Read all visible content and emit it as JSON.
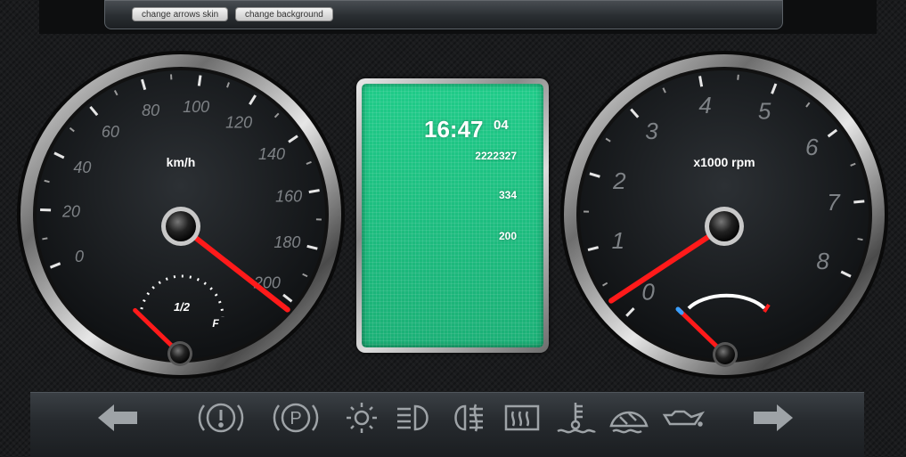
{
  "toolbar": {
    "arrows_label": "change arrows skin",
    "background_label": "change background"
  },
  "speedometer": {
    "unit": "km/h",
    "ticks": [
      "0",
      "20",
      "40",
      "60",
      "80",
      "100",
      "120",
      "140",
      "160",
      "180",
      "200"
    ],
    "speed_value": 200
  },
  "fuel": {
    "half_label": "1/2",
    "full_label": "F",
    "level_fraction": 0.0
  },
  "tachometer": {
    "unit": "x1000 rpm",
    "ticks": [
      "0",
      "1",
      "2",
      "3",
      "4",
      "5",
      "6",
      "7",
      "8"
    ],
    "rpm_value": 0.4
  },
  "temperature": {
    "level_fraction": 0.0
  },
  "lcd": {
    "clock": "16:47",
    "seconds": "04",
    "odometer": "2222327",
    "trip": "334",
    "value3": "200"
  },
  "colors": {
    "needle": "#ff1a1a",
    "lcd": "#21d690"
  },
  "indicators": [
    "turn-left-icon",
    "brake-warning-icon",
    "parking-brake-icon",
    "sidelights-icon",
    "headlight-icon",
    "fog-light-icon",
    "rear-defrost-icon",
    "coolant-temp-icon",
    "washer-fluid-icon",
    "oil-pressure-icon",
    "turn-right-icon"
  ]
}
